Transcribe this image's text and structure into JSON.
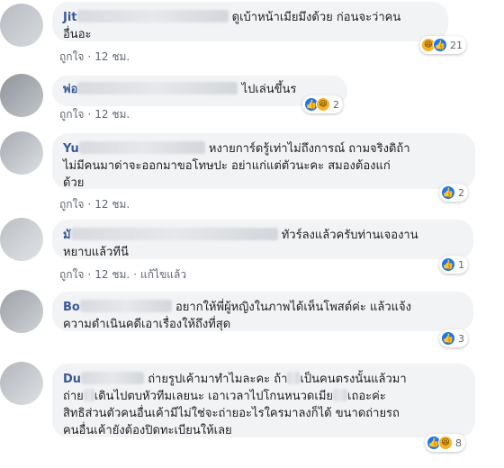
{
  "comments": [
    {
      "name": "Jit",
      "text_line1": "ดูเบ้าหน้าเมียมึงด้วย ก่อนจะว่าคน",
      "text_line2": "อื่นอะ",
      "like_label": "ถูกใจ",
      "time": "12 ชม.",
      "reaction_count": "21",
      "reactions": [
        "haha-icon",
        "like-icon"
      ]
    },
    {
      "name": "พ่อ",
      "text_line1": "ไปเล่นขึ้นร",
      "like_label": "ถูกใจ",
      "time": "12 ชม.",
      "reaction_count": "2",
      "reactions": [
        "like-icon",
        "haha-icon"
      ]
    },
    {
      "name": "Yu",
      "text_line1": "หงายการ์ดรู้เท่าไม่ถึงการณ์ ถามจริงดิถ้า",
      "text_line2": "ไม่มีคนมาด่าจะออกมาขอโทษปะ อย่าแก่แต่ตัวนะคะ สมองต้องแก่",
      "text_line3": "ด้วย",
      "like_label": "ถูกใจ",
      "time": "12 ชม.",
      "reaction_count": "2",
      "reactions": [
        "like-icon"
      ]
    },
    {
      "name": "มั",
      "text_line1": "ทัวร์ลงแล้วครับท่านเจองาน",
      "text_line2": "หยาบแล้วทีนี",
      "like_label": "ถูกใจ",
      "time": "12 ชม.",
      "edited_label": "แก้ไขแล้ว",
      "reaction_count": "1",
      "reactions": [
        "like-icon"
      ]
    },
    {
      "name": "Bo",
      "text_line1": "อยากให้พี่ผู้หญิงในภาพได้เห็นโพสต์ค่ะ แล้วแจ้ง",
      "text_line2": "ความดำเนินคดีเอาเรื่องให้ถึงที่สุด",
      "like_label": "ถูกใจ",
      "time": "12 ชม.",
      "reaction_count": "3",
      "reactions": [
        "like-icon"
      ]
    },
    {
      "name": "Du",
      "text_line1": "ถ่ายรูปเค้ามาทำไมละคะ ถ้า",
      "text_line1b": "เป็นคนตรงนั้นแล้วมา",
      "text_line2": "ถ่าย",
      "text_line2b": "เดินไปตบหัวทีมเลยนะ เอาเวลาไปโกนหนวดเมีย",
      "text_line2c": "เถอะค่ะ",
      "text_line3": "สิทธิส่วนตัวคนอื่นเค้ามีไม่ใช่จะถ่ายอะไรใครมาลงก็ได้ ขนาดถ่ายรถ",
      "text_line4": "คนอื่นเค้ายังต้องปิดทะเบียนให้เลย",
      "reaction_count": "8",
      "reactions": [
        "like-icon",
        "haha-icon"
      ]
    }
  ],
  "colors": {
    "bubble": "#f2f3f5",
    "name": "#385898",
    "like": "#1877f2",
    "haha": "#f7b125",
    "meta": "#606770"
  }
}
